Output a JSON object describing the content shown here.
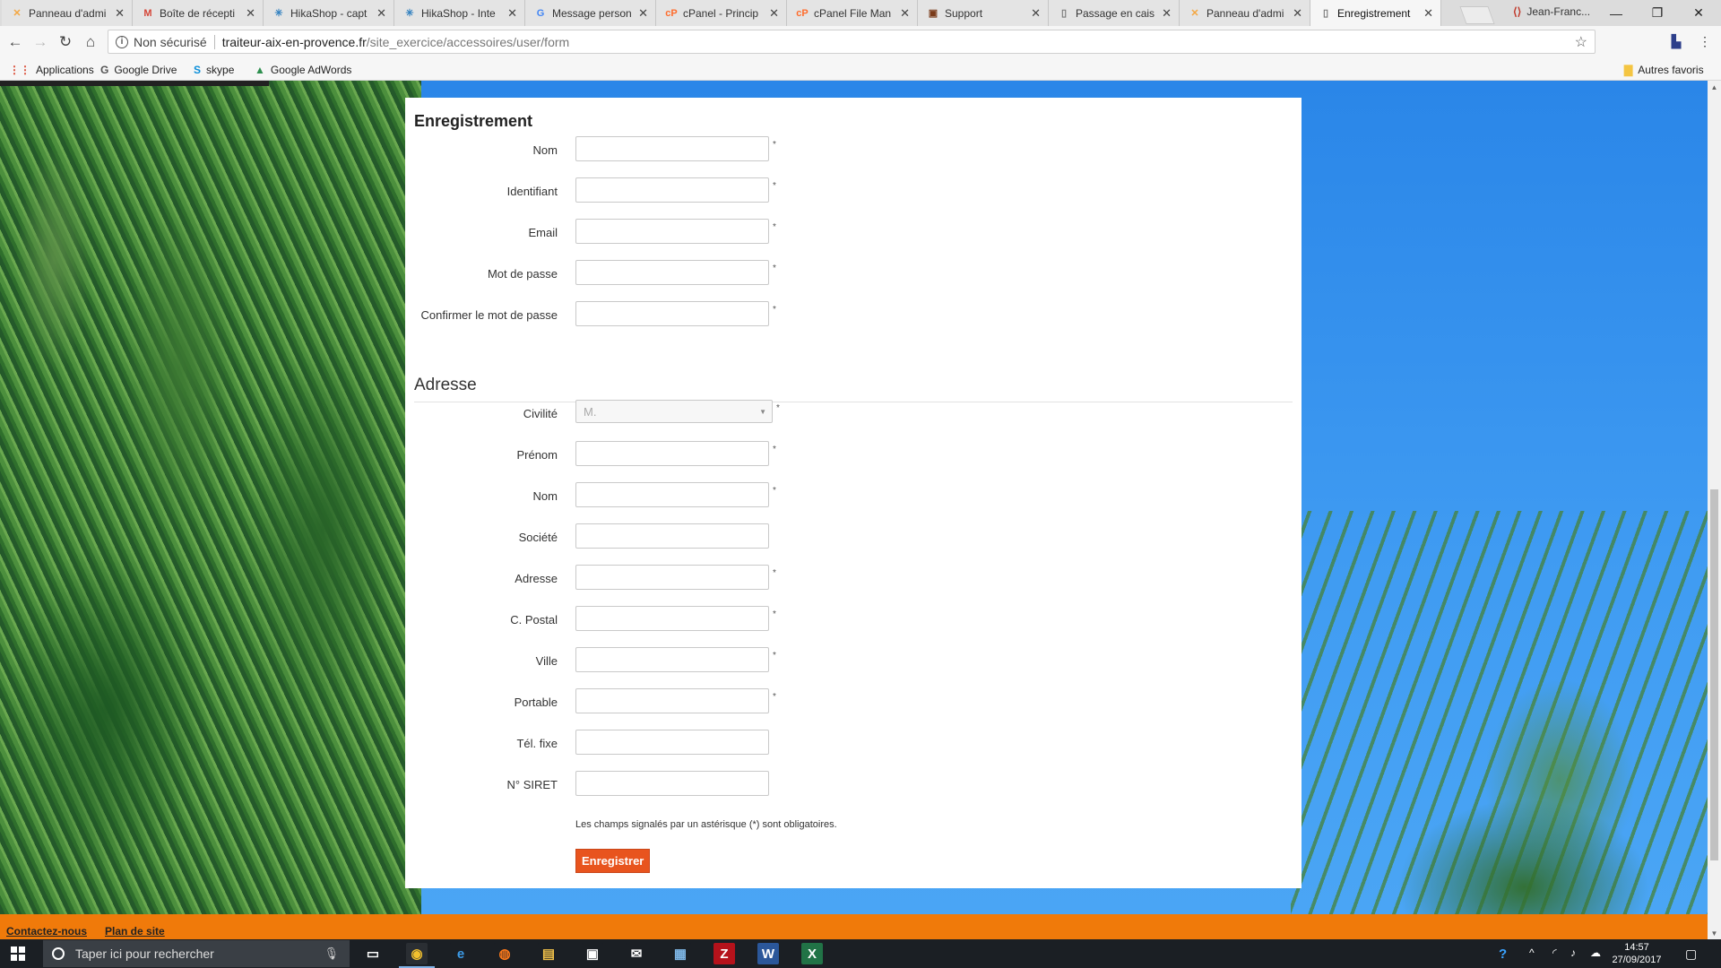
{
  "browser": {
    "tabs": [
      {
        "title": "Panneau d'admi",
        "icon": "joomla-icon",
        "color": "#f4a742"
      },
      {
        "title": "Boîte de récepti",
        "icon": "gmail-icon",
        "color": "#d44638"
      },
      {
        "title": "HikaShop - capt",
        "icon": "hikashop-icon",
        "color": "#2f7fbf"
      },
      {
        "title": "HikaShop - Inte",
        "icon": "hikashop-icon",
        "color": "#2f7fbf"
      },
      {
        "title": "Message person",
        "icon": "google-icon",
        "color": "#4285f4"
      },
      {
        "title": "cPanel - Princip",
        "icon": "cpanel-icon",
        "color": "#ff6c2c"
      },
      {
        "title": "cPanel File Man",
        "icon": "cpanel-icon",
        "color": "#ff6c2c"
      },
      {
        "title": "Support",
        "icon": "support-icon",
        "color": "#7a3b1a"
      },
      {
        "title": "Passage en cais",
        "icon": "document-icon",
        "color": "#777777"
      },
      {
        "title": "Panneau d'admi",
        "icon": "joomla-icon",
        "color": "#f4a742"
      },
      {
        "title": "Enregistrement",
        "icon": "document-icon",
        "color": "#777777",
        "active": true
      }
    ],
    "profile_name": "Jean-Franc...",
    "security_label": "Non sécurisé",
    "url_host": "traiteur-aix-en-provence.fr",
    "url_path": "/site_exercice/accessoires/user/form",
    "bookmarks": [
      {
        "label": "Applications",
        "icon": "apps-grid-icon"
      },
      {
        "label": "Google Drive",
        "icon": "google-icon"
      },
      {
        "label": "skype",
        "icon": "skype-icon"
      },
      {
        "label": "Google AdWords",
        "icon": "adwords-icon"
      }
    ],
    "other_bookmarks": "Autres favoris"
  },
  "form": {
    "heading_registration": "Enregistrement",
    "registration_fields": [
      {
        "label": "Nom",
        "value": "",
        "required": true
      },
      {
        "label": "Identifiant",
        "value": "",
        "required": true
      },
      {
        "label": "Email",
        "value": "",
        "required": true
      },
      {
        "label": "Mot de passe",
        "value": "",
        "required": true
      },
      {
        "label": "Confirmer le mot de passe",
        "value": "",
        "required": true
      }
    ],
    "heading_address": "Adresse",
    "civility": {
      "label": "Civilité",
      "selected": "M.",
      "required": true
    },
    "address_fields": [
      {
        "label": "Prénom",
        "value": "",
        "required": true
      },
      {
        "label": "Nom",
        "value": "",
        "required": true
      },
      {
        "label": "Société",
        "value": "",
        "required": false
      },
      {
        "label": "Adresse",
        "value": "",
        "required": true
      },
      {
        "label": "C. Postal",
        "value": "",
        "required": true
      },
      {
        "label": "Ville",
        "value": "",
        "required": true
      },
      {
        "label": "Portable",
        "value": "",
        "required": true
      },
      {
        "label": "Tél. fixe",
        "value": "",
        "required": false
      },
      {
        "label": "N° SIRET",
        "value": "",
        "required": false
      }
    ],
    "required_mark": "*",
    "required_note": "Les champs signalés par un astérisque (*) sont obligatoires.",
    "submit_label": "Enregistrer",
    "accent_color": "#e8541e"
  },
  "footer": {
    "links": [
      "Contactez-nous",
      "Plan de site"
    ],
    "color": "#f07a0a"
  },
  "taskbar": {
    "search_placeholder": "Taper ici pour rechercher",
    "apps": [
      {
        "name": "task-view-icon",
        "glyph": "▭"
      },
      {
        "name": "chrome-icon",
        "glyph": "◉",
        "active": true
      },
      {
        "name": "edge-icon",
        "glyph": "e"
      },
      {
        "name": "firefox-icon",
        "glyph": "◍"
      },
      {
        "name": "file-explorer-icon",
        "glyph": "▤"
      },
      {
        "name": "store-icon",
        "glyph": "▣"
      },
      {
        "name": "mail-icon",
        "glyph": "✉"
      },
      {
        "name": "remote-desktop-icon",
        "glyph": "▦"
      },
      {
        "name": "filezilla-icon",
        "glyph": "Z"
      },
      {
        "name": "word-icon",
        "glyph": "W"
      },
      {
        "name": "excel-icon",
        "glyph": "X"
      }
    ],
    "time": "14:57",
    "date": "27/09/2017"
  }
}
